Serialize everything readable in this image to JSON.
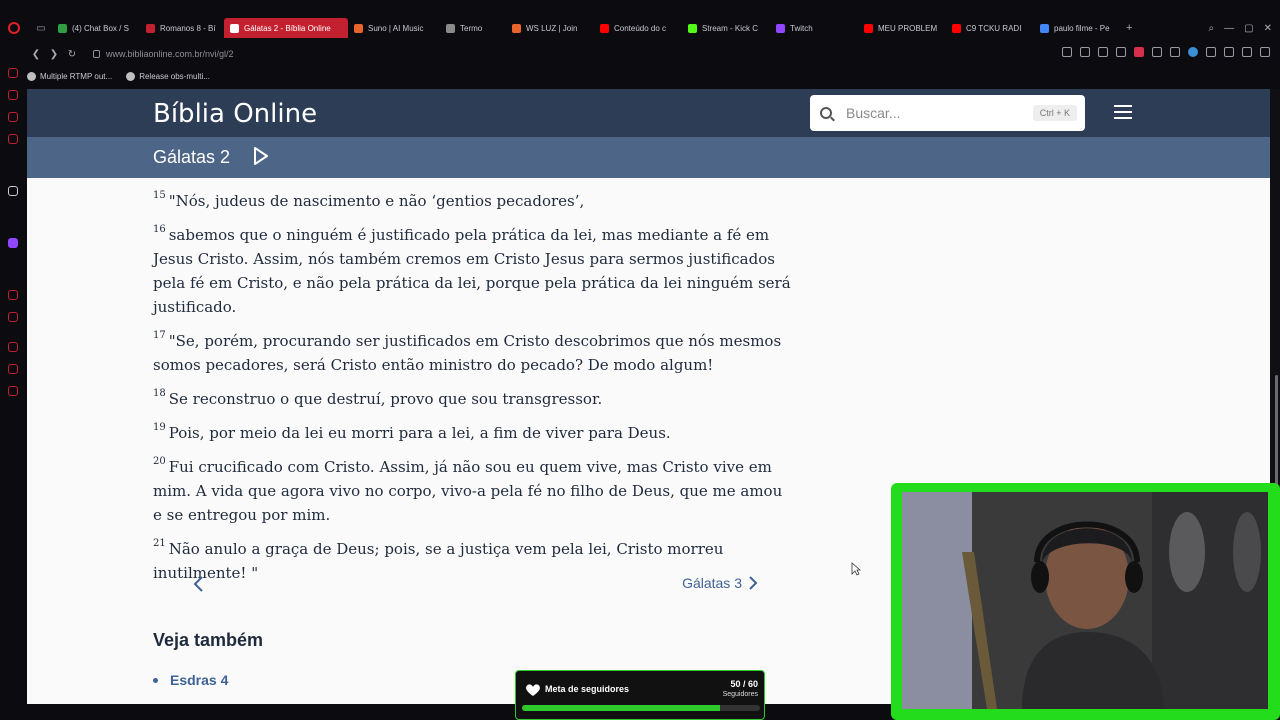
{
  "browser": {
    "tabs": [
      {
        "label": "(4) Chat Box / S",
        "color": "#2ea043"
      },
      {
        "label": "Romanos 8 - Bí",
        "color": "#c42130"
      },
      {
        "label": "Gálatas 2 - Bíblia Online",
        "color": "#ffffff",
        "active": true
      },
      {
        "label": "Suno | AI Music",
        "color": "#e8642a"
      },
      {
        "label": "Termo",
        "color": "#8a8a8a"
      },
      {
        "label": "WS LUZ | Join",
        "color": "#e8642a"
      },
      {
        "label": "Conteúdo do c",
        "color": "#ff0000"
      },
      {
        "label": "Stream - Kick C",
        "color": "#53fc18"
      },
      {
        "label": "Twitch",
        "color": "#9146ff"
      },
      {
        "label": "MEU PROBLEM",
        "color": "#ff0000"
      },
      {
        "label": "C9 TCKU RADI",
        "color": "#ff0000"
      },
      {
        "label": "paulo filme - Pe",
        "color": "#4285f4"
      }
    ],
    "url": "www.bibliaonline.com.br/nvi/gl/2",
    "bookmarks": [
      {
        "label": "Multiple RTMP out..."
      },
      {
        "label": "Release obs-multi..."
      }
    ]
  },
  "site": {
    "brand": "Bíblia Online",
    "search_placeholder": "Buscar...",
    "search_shortcut": "Ctrl + K",
    "chapter_title": "Gálatas 2"
  },
  "verses": [
    {
      "num": "15",
      "text": "\"Nós, judeus de nascimento e não ‘gentios pecadores’,"
    },
    {
      "num": "16",
      "text": "sabemos que o ninguém é justificado pela prática da lei, mas mediante a fé em Jesus Cristo. Assim, nós também cremos em Cristo Jesus para sermos justificados pela fé em Cristo, e não pela prática da lei, porque pela prática da lei ninguém será justificado."
    },
    {
      "num": "17",
      "text": "\"Se, porém, procurando ser justificados em Cristo descobrimos que nós mesmos somos pecadores, será Cristo então ministro do pecado? De modo algum!"
    },
    {
      "num": "18",
      "text": "Se reconstruo o que destruí, provo que sou transgressor."
    },
    {
      "num": "19",
      "text": "Pois, por meio da lei eu morri para a lei, a fim de viver para Deus."
    },
    {
      "num": "20",
      "text": "Fui crucificado com Cristo. Assim, já não sou eu quem vive, mas Cristo vive em mim. A vida que agora vivo no corpo, vivo-a pela fé no filho de Deus, que me amou e se entregou por mim."
    },
    {
      "num": "21",
      "text": "Não anulo a graça de Deus; pois, se a justiça vem pela lei, Cristo morreu inutilmente! \""
    }
  ],
  "pager": {
    "next_label": "Gálatas 3"
  },
  "see_also": {
    "title": "Veja também",
    "items": [
      "Esdras 4"
    ]
  },
  "goal": {
    "label": "Meta de seguidores",
    "count": "50 / 60",
    "sub": "Seguidores",
    "progress": 0.83
  },
  "colors": {
    "header": "#2d3d55",
    "subheader": "#4d6587",
    "link": "#3f6295",
    "cam_border": "#23dd1c"
  }
}
